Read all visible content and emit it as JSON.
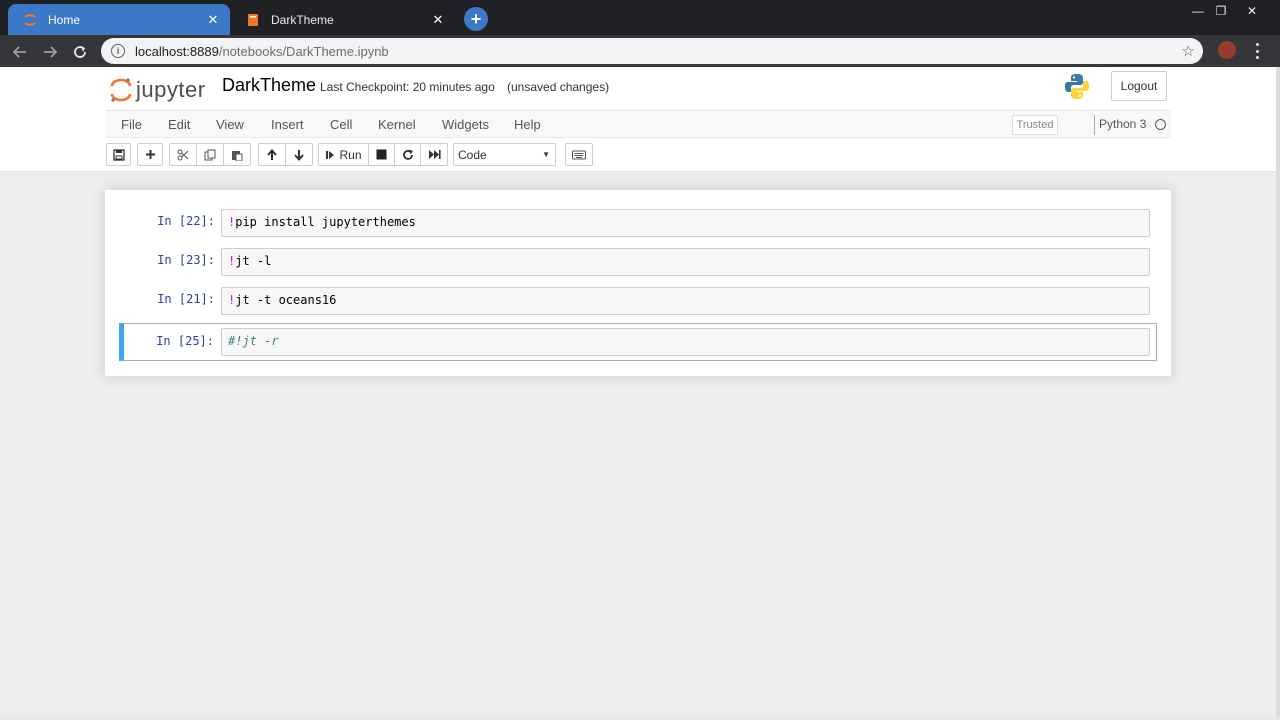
{
  "browser": {
    "tabs": [
      {
        "title": "Home",
        "active": true,
        "icon": "jupyter-icon"
      },
      {
        "title": "DarkTheme",
        "active": false,
        "icon": "notebook-icon"
      }
    ],
    "close_glyph": "✕",
    "new_tab_glyph": "+",
    "window_controls": {
      "minimize": "—",
      "maximize": "❐",
      "close": "✕"
    },
    "url_host": "localhost:8889",
    "url_path": "/notebooks/DarkTheme.ipynb",
    "accent_color": "#3b78c8"
  },
  "jupyter": {
    "logo_text": "jupyter",
    "notebook_name": "DarkTheme",
    "checkpoint": "Last Checkpoint: 20 minutes ago",
    "save_status": "(unsaved changes)",
    "logout_label": "Logout",
    "menu": [
      "File",
      "Edit",
      "View",
      "Insert",
      "Cell",
      "Kernel",
      "Widgets",
      "Help"
    ],
    "trusted_label": "Trusted",
    "kernel_name": "Python 3",
    "toolbar": {
      "run_label": "Run",
      "cell_type": "Code"
    }
  },
  "cells": [
    {
      "prompt": "In [22]:",
      "bang": "!",
      "code": "pip install jupyterthemes",
      "selected": false
    },
    {
      "prompt": "In [23]:",
      "bang": "!",
      "code": "jt -l",
      "selected": false
    },
    {
      "prompt": "In [21]:",
      "bang": "!",
      "code": "jt -t oceans16",
      "selected": false
    },
    {
      "prompt": "In [25]:",
      "comment": "#!jt -r",
      "selected": true
    }
  ]
}
